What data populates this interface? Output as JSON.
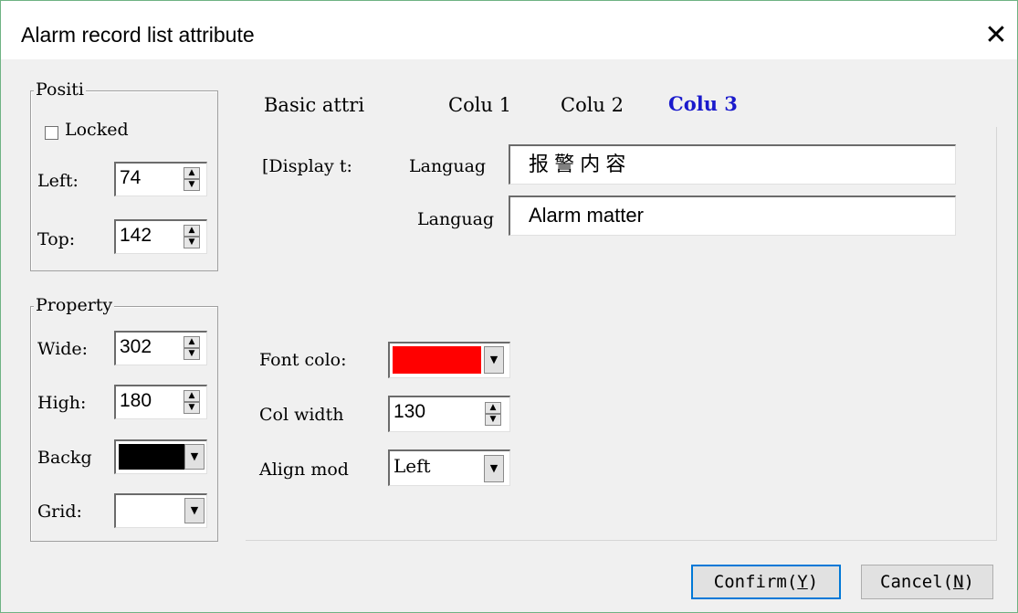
{
  "dialog": {
    "title": "Alarm record list attribute",
    "close_glyph": "✕"
  },
  "position": {
    "group_label": "Positi",
    "locked_label": "Locked",
    "locked_checked": false,
    "left_label": "Left:",
    "left_value": "74",
    "top_label": "Top:",
    "top_value": "142"
  },
  "property": {
    "group_label": "Property",
    "wide_label": "Wide:",
    "wide_value": "302",
    "high_label": "High:",
    "high_value": "180",
    "background_label": "Backg",
    "background_color": "#000000",
    "grid_label": "Grid:",
    "grid_color": "#ffffff"
  },
  "tabs": [
    {
      "label": "Basic attri",
      "active": false
    },
    {
      "label": "Colu 1",
      "active": false
    },
    {
      "label": "Colu 2",
      "active": false
    },
    {
      "label": "Colu 3",
      "active": true
    }
  ],
  "column3": {
    "display_text_label": "[Display t:",
    "language1_label": "Languag",
    "language1_value": "报 警 内 容",
    "language2_label": "Languag",
    "language2_value": "Alarm matter",
    "font_color_label": "Font colo:",
    "font_color": "#ff0000",
    "col_width_label": "Col width",
    "col_width_value": "130",
    "align_mode_label": "Align mod",
    "align_mode_value": "Left"
  },
  "buttons": {
    "confirm_label": "Confirm(",
    "confirm_key": "Y",
    "cancel_label": "Cancel(",
    "cancel_key": "N",
    "close_paren": ")"
  },
  "icons": {
    "spin_up": "▲",
    "spin_down": "▼",
    "dropdown": "▼"
  },
  "colors": {
    "active_tab": "#1a1acc",
    "default_button_border": "#0078d7"
  }
}
